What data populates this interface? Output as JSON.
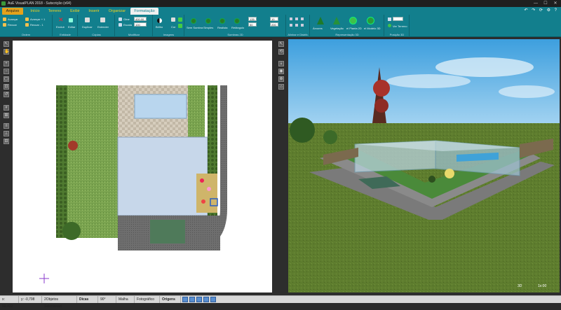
{
  "window": {
    "title": "AuE VisualPLAN 2018 - Sutscrição (x64)",
    "controls": [
      "—",
      "☐",
      "✕"
    ]
  },
  "menu": {
    "file": "Arquivo",
    "tabs": [
      "Início",
      "Terreno",
      "Exibir",
      "Inserir",
      "Organizar"
    ],
    "active_tab": "Formatação",
    "right_icons": "↶ ↷ ⟳ ⚙ ?"
  },
  "ribbon": {
    "groups": [
      {
        "label": "Ordem",
        "items": [
          "Avançar",
          "Recuar",
          "Avançar + 1",
          "Recuar - 1"
        ]
      },
      {
        "label": "Entidade",
        "items": [
          "Excluir",
          "Editar"
        ]
      },
      {
        "label": "Cópias",
        "items": [
          "Duplicar",
          "Estender"
        ]
      },
      {
        "label": "Modificar",
        "items": [
          "Girar",
          "Escala"
        ],
        "fields": [
          "400.00",
          "100"
        ]
      },
      {
        "label": "Imagens",
        "items": [
          "Brilho",
          "Cor"
        ]
      },
      {
        "label": "Sombras 2D",
        "items": [
          "Sem Sombra",
          "Simples",
          "Realista",
          "Retângulo"
        ],
        "fields": [
          "135",
          "50",
          "10",
          "200"
        ]
      },
      {
        "label": "Alinhar e Distrib.",
        "items": []
      },
      {
        "label": "Representação 3D",
        "items": [
          "Árvores",
          "Vegetação",
          "el Planta 2D",
          "el Modelo 3D"
        ]
      },
      {
        "label": "Posição 3D",
        "items": [
          "Ver Terreno"
        ]
      }
    ]
  },
  "plan": {
    "name": "2D plan view"
  },
  "view3d": {
    "footer_left": "3D",
    "footer_right": "1x:00"
  },
  "status": {
    "x": "x: 50,422",
    "y": "y: -0,798",
    "selected": "2Objetos Selecionad",
    "hints": "Dicas",
    "angle": "90°",
    "mesh": "Malha",
    "photo": "Fotográfico",
    "origins": "Origens"
  },
  "colors": {
    "menu_teal": "#127f8d",
    "file_orange": "#e4a21b",
    "lawn": "#7aa34f",
    "pool": "#b9d6ee",
    "road": "#707070",
    "sky": "#4aa8e0"
  }
}
